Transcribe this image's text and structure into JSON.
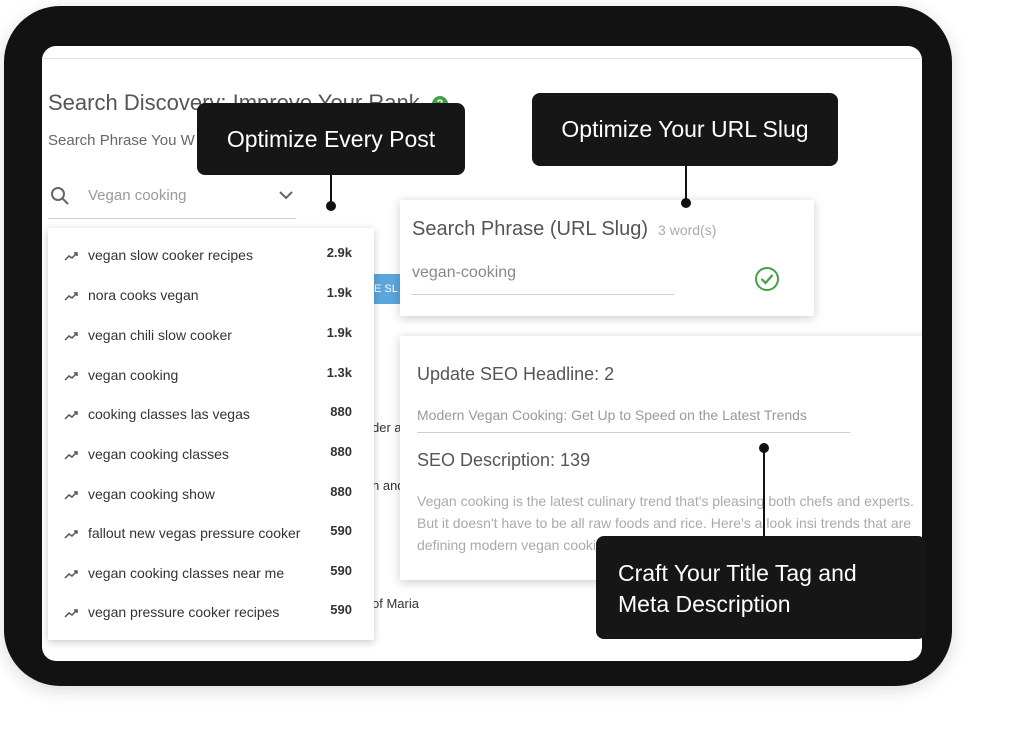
{
  "page": {
    "title": "Search Discovery: Improve Your Rank",
    "help_icon": "question-circle-icon",
    "phrase_label": "Search Phrase You W"
  },
  "search": {
    "value": "Vegan cooking",
    "icon": "search-icon",
    "dropdown_icon": "chevron-down-icon"
  },
  "suggestions": [
    {
      "term": "vegan slow cooker recipes",
      "volume": "2.9k"
    },
    {
      "term": "nora cooks vegan",
      "volume": "1.9k"
    },
    {
      "term": "vegan chili slow cooker",
      "volume": "1.9k"
    },
    {
      "term": "vegan cooking",
      "volume": "1.3k"
    },
    {
      "term": "cooking classes las vegas",
      "volume": "880"
    },
    {
      "term": "vegan cooking classes",
      "volume": "880"
    },
    {
      "term": "vegan cooking show",
      "volume": "880"
    },
    {
      "term": "fallout new vegas pressure cooker",
      "volume": "590"
    },
    {
      "term": "vegan cooking classes near me",
      "volume": "590"
    },
    {
      "term": "vegan pressure cooker recipes",
      "volume": "590"
    }
  ],
  "background": {
    "button_fragment": "E SL",
    "fragments": [
      "der a",
      "n and",
      "of Maria"
    ]
  },
  "url_card": {
    "label": "Search Phrase (URL Slug)",
    "word_count": "3 word(s)",
    "value": "vegan-cooking",
    "status_icon": "check-circle-icon",
    "status_color": "#43a047"
  },
  "seo_card": {
    "headline_label": "Update SEO Headline: 2",
    "headline_value": "Modern Vegan Cooking: Get Up to Speed on the Latest Trends",
    "description_label": "SEO Description: 139",
    "description_text": "Vegan cooking is the latest culinary trend that's pleasing both chefs and experts. But it doesn't have to be all raw foods and rice. Here's a look insi trends that are defining modern vegan cooking."
  },
  "callouts": {
    "optimize_post": "Optimize Every Post",
    "optimize_slug": "Optimize Your URL Slug",
    "title_tag_line1": "Craft Your Title Tag and",
    "title_tag_line2": "Meta Description"
  }
}
